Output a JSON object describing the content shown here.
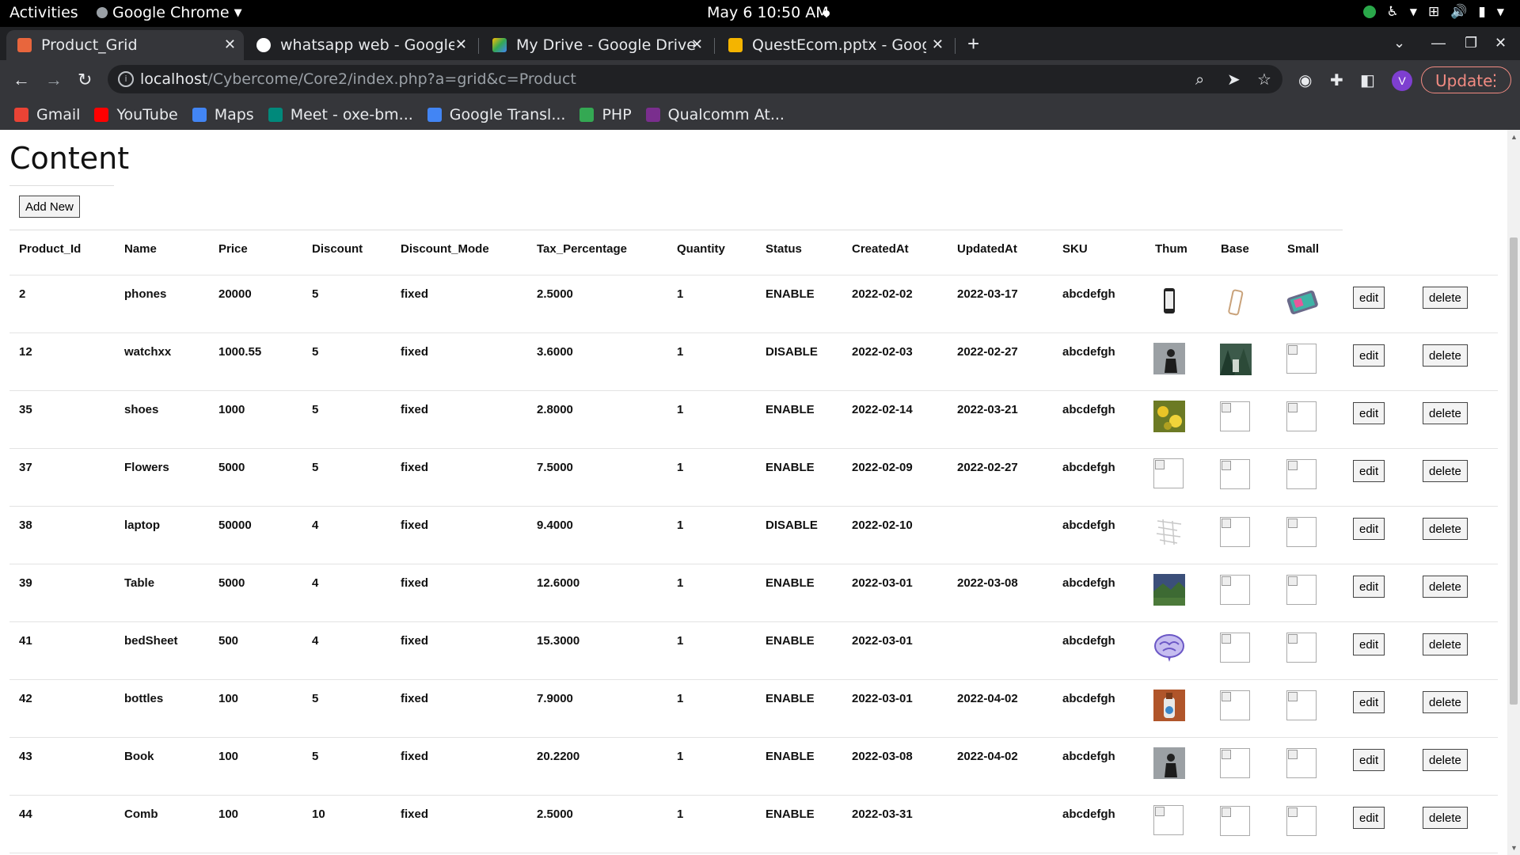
{
  "topbar": {
    "activities": "Activities",
    "app": "Google Chrome",
    "clock": "May 6  10:50 AM"
  },
  "tabs": [
    {
      "label": "Product_Grid"
    },
    {
      "label": "whatsapp web - Google Se"
    },
    {
      "label": "My Drive - Google Drive"
    },
    {
      "label": "QuestEcom.pptx - Google"
    }
  ],
  "omnibox": {
    "host": "localhost",
    "path": "/Cybercome/Core2/index.php?a=grid&c=Product"
  },
  "update_label": "Update",
  "profile_initial": "V",
  "bookmarks": [
    {
      "label": "Gmail",
      "icon": "gmail-icon",
      "color": "#ea4335"
    },
    {
      "label": "YouTube",
      "icon": "youtube-icon",
      "color": "#ff0000"
    },
    {
      "label": "Maps",
      "icon": "google-icon",
      "color": "#4285f4"
    },
    {
      "label": "Meet - oxe-bm...",
      "icon": "meet-icon",
      "color": "#00897b"
    },
    {
      "label": "Google Transl...",
      "icon": "translate-icon",
      "color": "#4285f4"
    },
    {
      "label": "PHP",
      "icon": "php-icon",
      "color": "#34a853"
    },
    {
      "label": "Qualcomm At...",
      "icon": "qualcomm-icon",
      "color": "#7a2e8e"
    }
  ],
  "page": {
    "title": "Content",
    "add_new": "Add New",
    "columns": [
      "Product_Id",
      "Name",
      "Price",
      "Discount",
      "Discount_Mode",
      "Tax_Percentage",
      "Quantity",
      "Status",
      "CreatedAt",
      "UpdatedAt",
      "SKU",
      "Thum",
      "Base",
      "Small"
    ],
    "edit_label": "edit",
    "delete_label": "delete",
    "rows": [
      {
        "id": "2",
        "name": "phones",
        "price": "20000",
        "discount": "5",
        "mode": "fixed",
        "tax": "2.5000",
        "qty": "1",
        "status": "ENABLE",
        "created": "2022-02-02",
        "updated": "2022-03-17",
        "sku": "abcdefgh",
        "thum": "phone",
        "base": "phone-case",
        "small": "phone-color"
      },
      {
        "id": "12",
        "name": "watchxx",
        "price": "1000.55",
        "discount": "5",
        "mode": "fixed",
        "tax": "3.6000",
        "qty": "1",
        "status": "DISABLE",
        "created": "2022-02-03",
        "updated": "2022-02-27",
        "sku": "abcdefgh",
        "thum": "person",
        "base": "forest",
        "small": "broken"
      },
      {
        "id": "35",
        "name": "shoes",
        "price": "1000",
        "discount": "5",
        "mode": "fixed",
        "tax": "2.8000",
        "qty": "1",
        "status": "ENABLE",
        "created": "2022-02-14",
        "updated": "2022-03-21",
        "sku": "abcdefgh",
        "thum": "flowers",
        "base": "broken",
        "small": "broken"
      },
      {
        "id": "37",
        "name": "Flowers",
        "price": "5000",
        "discount": "5",
        "mode": "fixed",
        "tax": "7.5000",
        "qty": "1",
        "status": "ENABLE",
        "created": "2022-02-09",
        "updated": "2022-02-27",
        "sku": "abcdefgh",
        "thum": "broken",
        "base": "broken",
        "small": "broken"
      },
      {
        "id": "38",
        "name": "laptop",
        "price": "50000",
        "discount": "4",
        "mode": "fixed",
        "tax": "9.4000",
        "qty": "1",
        "status": "DISABLE",
        "created": "2022-02-10",
        "updated": "",
        "sku": "abcdefgh",
        "thum": "sketch",
        "base": "broken",
        "small": "broken"
      },
      {
        "id": "39",
        "name": "Table",
        "price": "5000",
        "discount": "4",
        "mode": "fixed",
        "tax": "12.6000",
        "qty": "1",
        "status": "ENABLE",
        "created": "2022-03-01",
        "updated": "2022-03-08",
        "sku": "abcdefgh",
        "thum": "landscape",
        "base": "broken",
        "small": "broken"
      },
      {
        "id": "41",
        "name": "bedSheet",
        "price": "500",
        "discount": "4",
        "mode": "fixed",
        "tax": "15.3000",
        "qty": "1",
        "status": "ENABLE",
        "created": "2022-03-01",
        "updated": "",
        "sku": "abcdefgh",
        "thum": "brain",
        "base": "broken",
        "small": "broken"
      },
      {
        "id": "42",
        "name": "bottles",
        "price": "100",
        "discount": "5",
        "mode": "fixed",
        "tax": "7.9000",
        "qty": "1",
        "status": "ENABLE",
        "created": "2022-03-01",
        "updated": "2022-04-02",
        "sku": "abcdefgh",
        "thum": "bottles",
        "base": "broken",
        "small": "broken"
      },
      {
        "id": "43",
        "name": "Book",
        "price": "100",
        "discount": "5",
        "mode": "fixed",
        "tax": "20.2200",
        "qty": "1",
        "status": "ENABLE",
        "created": "2022-03-08",
        "updated": "2022-04-02",
        "sku": "abcdefgh",
        "thum": "person",
        "base": "broken",
        "small": "broken"
      },
      {
        "id": "44",
        "name": "Comb",
        "price": "100",
        "discount": "10",
        "mode": "fixed",
        "tax": "2.5000",
        "qty": "1",
        "status": "ENABLE",
        "created": "2022-03-31",
        "updated": "",
        "sku": "abcdefgh",
        "thum": "broken",
        "base": "broken",
        "small": "broken"
      }
    ]
  }
}
